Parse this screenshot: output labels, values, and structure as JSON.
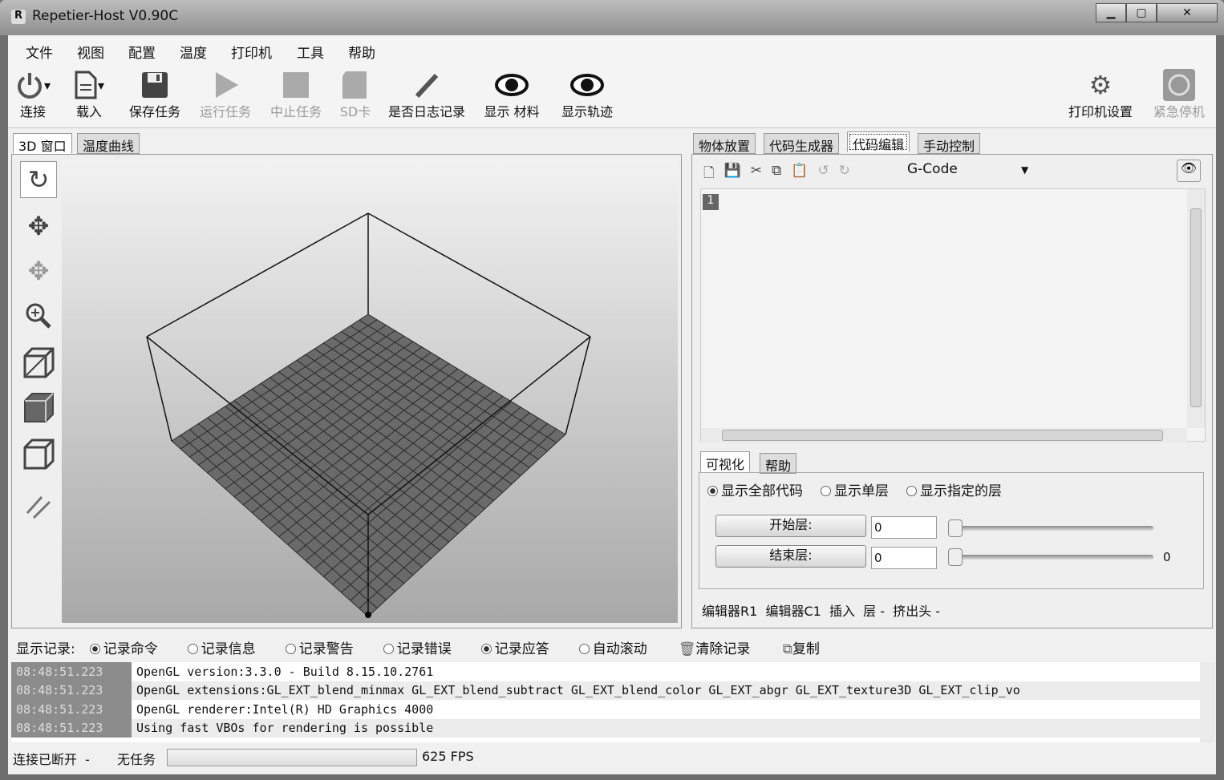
{
  "window": {
    "title": "Repetier-Host V0.90C",
    "app_icon": "R",
    "min": "▁",
    "max": "▢",
    "close": "✕"
  },
  "menu": [
    "文件",
    "视图",
    "配置",
    "温度",
    "打印机",
    "工具",
    "帮助"
  ],
  "toolbar": {
    "connect": "连接",
    "load": "载入",
    "save_job": "保存任务",
    "run_job": "运行任务",
    "stop_job": "中止任务",
    "sd_card": "SD卡",
    "toggle_log": "是否日志记录",
    "show_filament": "显示 材料",
    "show_travel": "显示轨迹",
    "printer_settings": "打印机设置",
    "emergency_stop": "紧急停机"
  },
  "left_tabs": [
    "3D 窗口",
    "温度曲线"
  ],
  "right_tabs": [
    "物体放置",
    "代码生成器",
    "代码编辑",
    "手动控制"
  ],
  "editor": {
    "language": "G-Code",
    "line_number": "1",
    "status": "编辑器R1  编辑器C1  插入  层 -  挤出头 -"
  },
  "visualization": {
    "tabs": [
      "可视化",
      "帮助"
    ],
    "radios": [
      {
        "label": "显示全部代码",
        "checked": true
      },
      {
        "label": "显示单层",
        "checked": false
      },
      {
        "label": "显示指定的层",
        "checked": false
      }
    ],
    "start_layer_label": "开始层:",
    "start_layer_value": "0",
    "end_layer_label": "结束层:",
    "end_layer_value": "0",
    "end_slider_readout": "0"
  },
  "log": {
    "label": "显示记录:",
    "options": [
      {
        "label": "记录命令",
        "checked": true
      },
      {
        "label": "记录信息",
        "checked": false
      },
      {
        "label": "记录警告",
        "checked": false
      },
      {
        "label": "记录错误",
        "checked": false
      },
      {
        "label": "记录应答",
        "checked": true
      },
      {
        "label": "自动滚动",
        "checked": false
      }
    ],
    "clear": "清除记录",
    "copy": "复制",
    "rows": [
      {
        "time": "08:48:51.223",
        "text": "OpenGL version:3.3.0 - Build 8.15.10.2761"
      },
      {
        "time": "08:48:51.223",
        "text": "OpenGL extensions:GL_EXT_blend_minmax GL_EXT_blend_subtract GL_EXT_blend_color GL_EXT_abgr GL_EXT_texture3D GL_EXT_clip_vo"
      },
      {
        "time": "08:48:51.223",
        "text": "OpenGL renderer:Intel(R) HD Graphics 4000"
      },
      {
        "time": "08:48:51.223",
        "text": "Using fast VBOs for rendering is possible"
      }
    ]
  },
  "status": {
    "connection": "连接已断开  -",
    "job": "无任务",
    "progress": 0,
    "fps": "625 FPS"
  }
}
